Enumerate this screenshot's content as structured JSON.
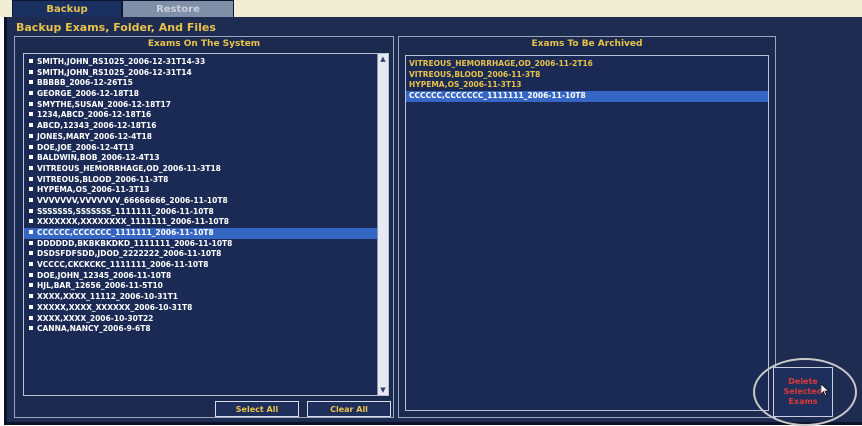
{
  "tabs": [
    {
      "label": "Backup",
      "active": true
    },
    {
      "label": "Restore",
      "active": false
    }
  ],
  "title": "Backup Exams, Folder, And Files",
  "left_panel": {
    "header": "Exams On The System",
    "items": [
      "SMITH,JOHN_RS1025_2006-12-31T14-33",
      "SMITH,JOHN_RS1025_2006-12-31T14",
      "BBBBB_2006-12-26T15",
      "GEORGE_2006-12-18T18",
      "SMYTHE,SUSAN_2006-12-18T17",
      "1234,ABCD_2006-12-18T16",
      "ABCD,12343_2006-12-18T16",
      "JONES,MARY_2006-12-4T18",
      "DOE,JOE_2006-12-4T13",
      "BALDWIN,BOB_2006-12-4T13",
      "VITREOUS_HEMORRHAGE,OD_2006-11-3T18",
      "VITREOUS,BLOOD_2006-11-3T8",
      "HYPEMA,OS_2006-11-3T13",
      "VVVVVVV,VVVVVVV_66666666_2006-11-10T8",
      "SSSSSSS,SSSSSSS_1111111_2006-11-10T8",
      "XXXXXXX,XXXXXXXX_1111111_2006-11-10T8",
      "CCCCCC,CCCCCCC_1111111_2006-11-10T8",
      "DDDDDD,BKBKBKDKD_1111111_2006-11-10T8",
      "DSDSFDFSDD,JDOD_2222222_2006-11-10T8",
      "VCCCC,CKCKCKC_1111111_2006-11-10T8",
      "DOE,JOHN_12345_2006-11-10T8",
      "HJL,BAR_12656_2006-11-5T10",
      "XXXX,XXXX_11112_2006-10-31T1",
      "XXXXX,XXXX_XXXXXX_2006-10-31T8",
      "XXXX,XXXX_2006-10-30T22",
      "CANNA,NANCY_2006-9-6T8"
    ],
    "selected_index": 16,
    "select_all_label": "Select All",
    "clear_all_label": "Clear All"
  },
  "right_panel": {
    "header": "Exams To Be Archived",
    "items": [
      "VITREOUS_HEMORRHAGE,OD_2006-11-2T16",
      "VITREOUS,BLOOD_2006-11-3T8",
      "HYPEMA,OS_2006-11-3T13",
      "CCCCCC,CCCCCCC_1111111_2006-11-10T8"
    ],
    "selected_index": 3
  },
  "delete_button": {
    "line1": "Delete",
    "line2": "Selected",
    "line3": "Exams"
  },
  "icons": {
    "scroll_up": "scroll-up-arrow-icon",
    "scroll_down": "scroll-down-arrow-icon",
    "cursor": "mouse-cursor-icon",
    "bullet": "square-bullet-icon"
  },
  "colors": {
    "background": "#1e2c52",
    "accent_text": "#e8c24a",
    "selection": "#3566c4",
    "delete_text": "#d83a3a"
  }
}
